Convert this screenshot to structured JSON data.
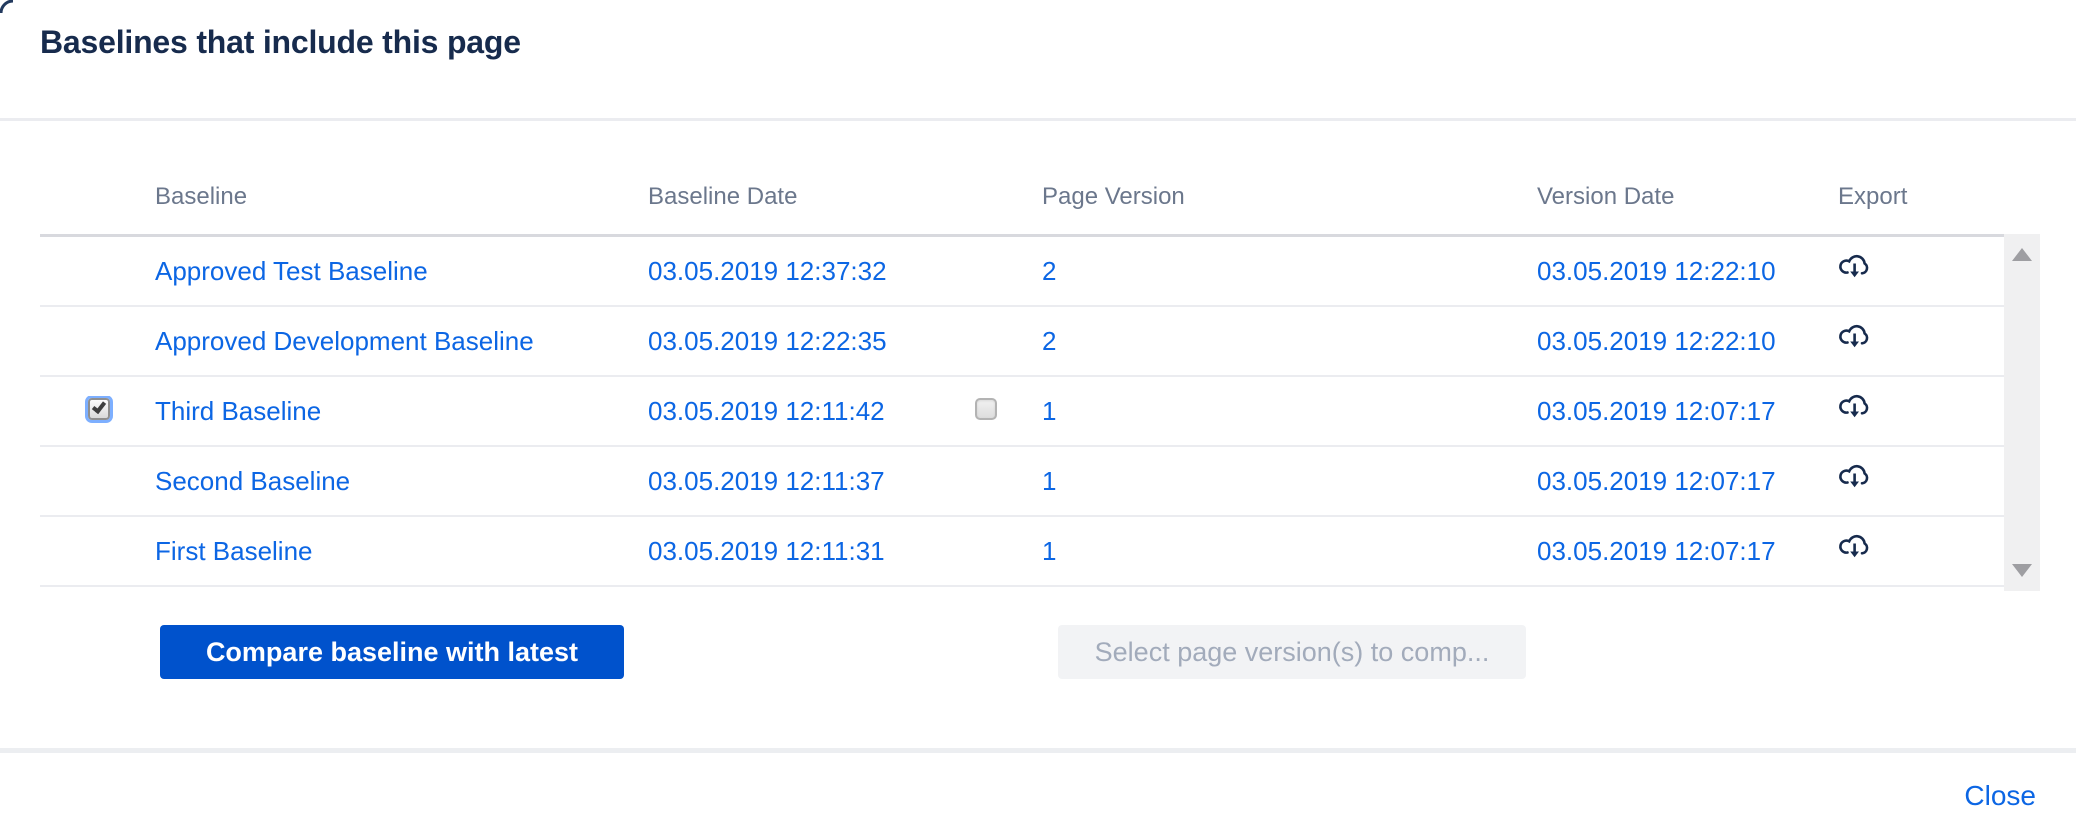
{
  "dialog": {
    "title": "Baselines that include this page",
    "close_label": "Close"
  },
  "table": {
    "columns": [
      "Baseline",
      "Baseline Date",
      "Page Version",
      "Version Date",
      "Export"
    ],
    "export_icon": "cloud-download-icon",
    "rows": [
      {
        "baseline": "Approved Test Baseline",
        "baseline_date": "03.05.2019 12:37:32",
        "page_version": "2",
        "version_date": "03.05.2019 12:22:10",
        "selected": false,
        "version_checkbox": false
      },
      {
        "baseline": "Approved Development Baseline",
        "baseline_date": "03.05.2019 12:22:35",
        "page_version": "2",
        "version_date": "03.05.2019 12:22:10",
        "selected": false,
        "version_checkbox": false
      },
      {
        "baseline": "Third Baseline",
        "baseline_date": "03.05.2019 12:11:42",
        "page_version": "1",
        "version_date": "03.05.2019 12:07:17",
        "selected": true,
        "version_checkbox": true
      },
      {
        "baseline": "Second Baseline",
        "baseline_date": "03.05.2019 12:11:37",
        "page_version": "1",
        "version_date": "03.05.2019 12:07:17",
        "selected": false,
        "version_checkbox": false
      },
      {
        "baseline": "First Baseline",
        "baseline_date": "03.05.2019 12:11:31",
        "page_version": "1",
        "version_date": "03.05.2019 12:07:17",
        "selected": false,
        "version_checkbox": false
      }
    ]
  },
  "actions": {
    "compare_label": "Compare baseline with latest",
    "select_versions_label": "Select page version(s) to comp..."
  },
  "colors": {
    "link": "#0C66E4",
    "primary_button": "#0052CC",
    "title_text": "#172B4D",
    "header_text": "#6B778C"
  }
}
